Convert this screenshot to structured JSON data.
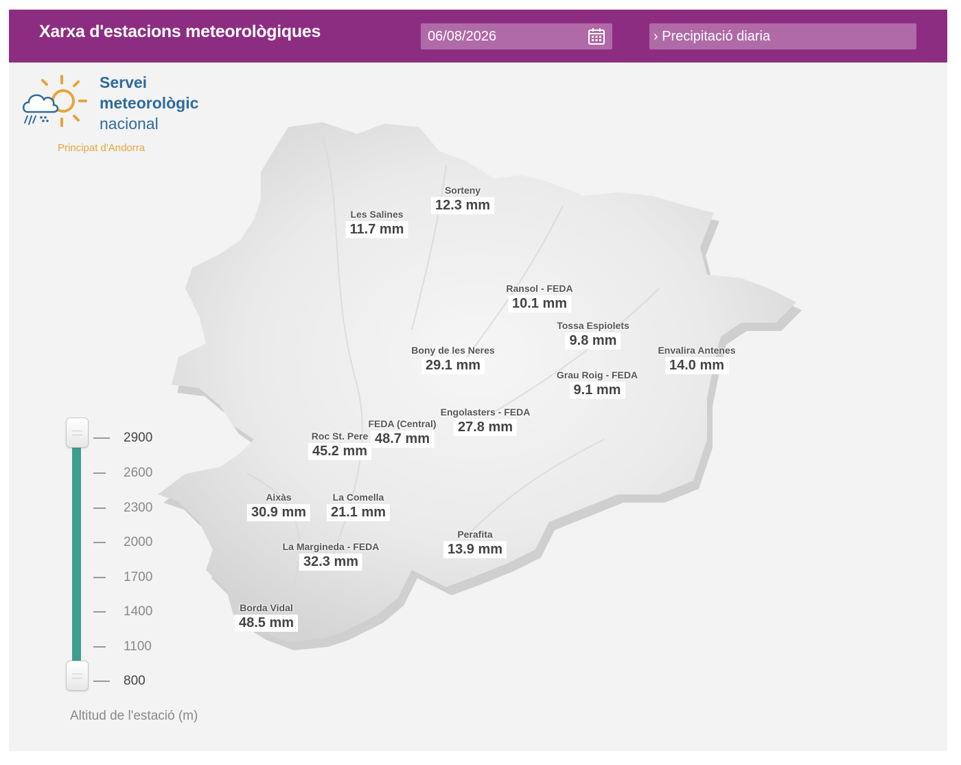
{
  "header": {
    "title": "Xarxa d'estacions meteorològiques",
    "date": "06/08/2026",
    "product": "› Precipitació diaria"
  },
  "logo": {
    "line1": "Servei",
    "line2": "meteorològic",
    "line3": "nacional",
    "subtitle": "Principat d'Andorra"
  },
  "stations": [
    {
      "name": "Sorteny",
      "value": "12.3 mm"
    },
    {
      "name": "Les Salines",
      "value": "11.7 mm"
    },
    {
      "name": "Ransol - FEDA",
      "value": "10.1 mm"
    },
    {
      "name": "Tossa Espiolets",
      "value": "9.8 mm"
    },
    {
      "name": "Bony de les Neres",
      "value": "29.1 mm"
    },
    {
      "name": "Envalira Antenes",
      "value": "14.0 mm"
    },
    {
      "name": "Grau Roig - FEDA",
      "value": "9.1 mm"
    },
    {
      "name": "Engolasters - FEDA",
      "value": "27.8 mm"
    },
    {
      "name": "FEDA (Central)",
      "value": "48.7 mm"
    },
    {
      "name": "Roc St. Pere",
      "value": "45.2 mm"
    },
    {
      "name": "Aixàs",
      "value": "30.9 mm"
    },
    {
      "name": "La Comella",
      "value": "21.1 mm"
    },
    {
      "name": "Perafita",
      "value": "13.9 mm"
    },
    {
      "name": "La Margineda - FEDA",
      "value": "32.3 mm"
    },
    {
      "name": "Borda Vidal",
      "value": "48.5 mm"
    }
  ],
  "altitude_slider": {
    "title": "Altitud de l'estació (m)",
    "ticks": [
      "2900",
      "2600",
      "2300",
      "2000",
      "1700",
      "1400",
      "1100",
      "800"
    ],
    "range_min": 800,
    "range_max": 2900,
    "accent_color": "#3f9e8e"
  },
  "colors": {
    "header": "#8d2d82",
    "field": "#b06aa7"
  }
}
